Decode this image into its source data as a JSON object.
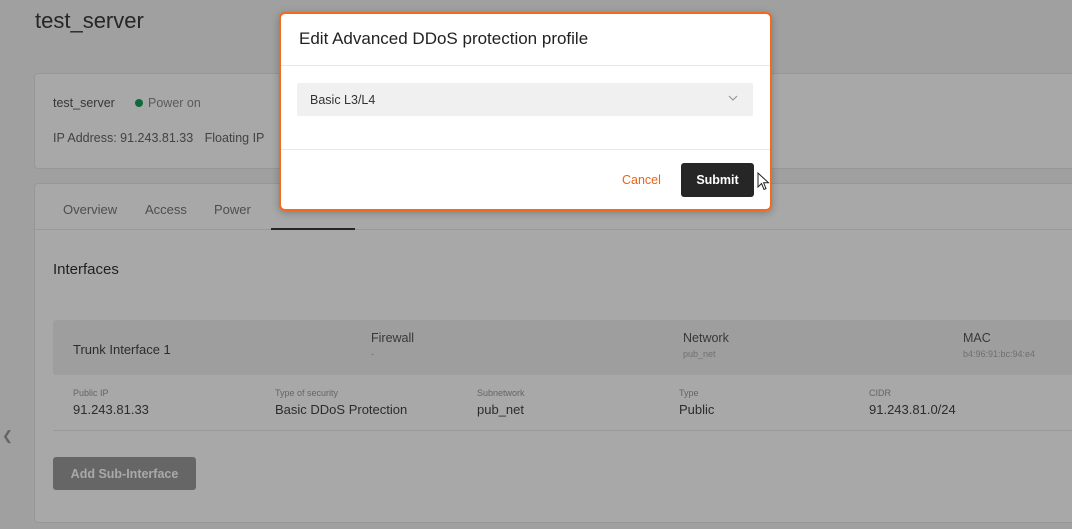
{
  "page": {
    "title": "test_server"
  },
  "summary": {
    "name": "test_server",
    "status": "Power on",
    "status_color": "#18a059",
    "ip_address": "IP Address: 91.243.81.33",
    "floating_ip": "Floating IP"
  },
  "tabs": [
    {
      "label": "Overview"
    },
    {
      "label": "Access"
    },
    {
      "label": "Power"
    }
  ],
  "interfaces": {
    "title": "Interfaces",
    "trunk": {
      "name": "Trunk Interface 1",
      "firewall_label": "Firewall",
      "firewall_value": "-",
      "network_label": "Network",
      "network_value": "pub_net",
      "mac_label": "MAC",
      "mac_value": "b4:96:91:bc:94:e4"
    },
    "detail": {
      "public_ip_label": "Public IP",
      "public_ip_value": "91.243.81.33",
      "security_label": "Type of security",
      "security_value": "Basic DDoS Protection",
      "subnetwork_label": "Subnetwork",
      "subnetwork_value": "pub_net",
      "type_label": "Type",
      "type_value": "Public",
      "cidr_label": "CIDR",
      "cidr_value": "91.243.81.0/24"
    },
    "add_button": "Add Sub-Interface"
  },
  "modal": {
    "title": "Edit Advanced DDoS protection profile",
    "selected": "Basic L3/L4",
    "cancel_label": "Cancel",
    "submit_label": "Submit",
    "accent_color": "#f26a22"
  },
  "icons": [
    "chevron-down-icon",
    "chevron-left-icon",
    "cursor-icon"
  ]
}
